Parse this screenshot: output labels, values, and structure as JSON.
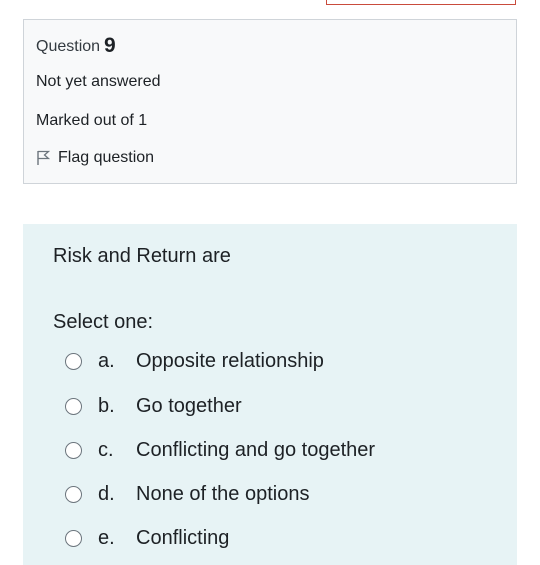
{
  "question": {
    "label": "Question",
    "number": "9",
    "status": "Not yet answered",
    "marks": "Marked out of 1",
    "flag_label": "Flag question"
  },
  "content": {
    "question_text": "Risk and Return are",
    "prompt": "Select one:",
    "options": [
      {
        "letter": "a.",
        "text": "Opposite relationship",
        "selected": false
      },
      {
        "letter": "b.",
        "text": "Go together",
        "selected": false
      },
      {
        "letter": "c.",
        "text": "Conflicting and go together",
        "selected": false
      },
      {
        "letter": "d.",
        "text": "None of the options",
        "selected": false
      },
      {
        "letter": "e.",
        "text": "Conflicting",
        "selected": false
      }
    ]
  },
  "icons": {
    "flag": "flag-icon"
  },
  "colors": {
    "info_background": "#f8f9fa",
    "content_background": "#e7f3f5",
    "border": "#cfd4d9",
    "top_strip_border": "#c94b3c"
  }
}
